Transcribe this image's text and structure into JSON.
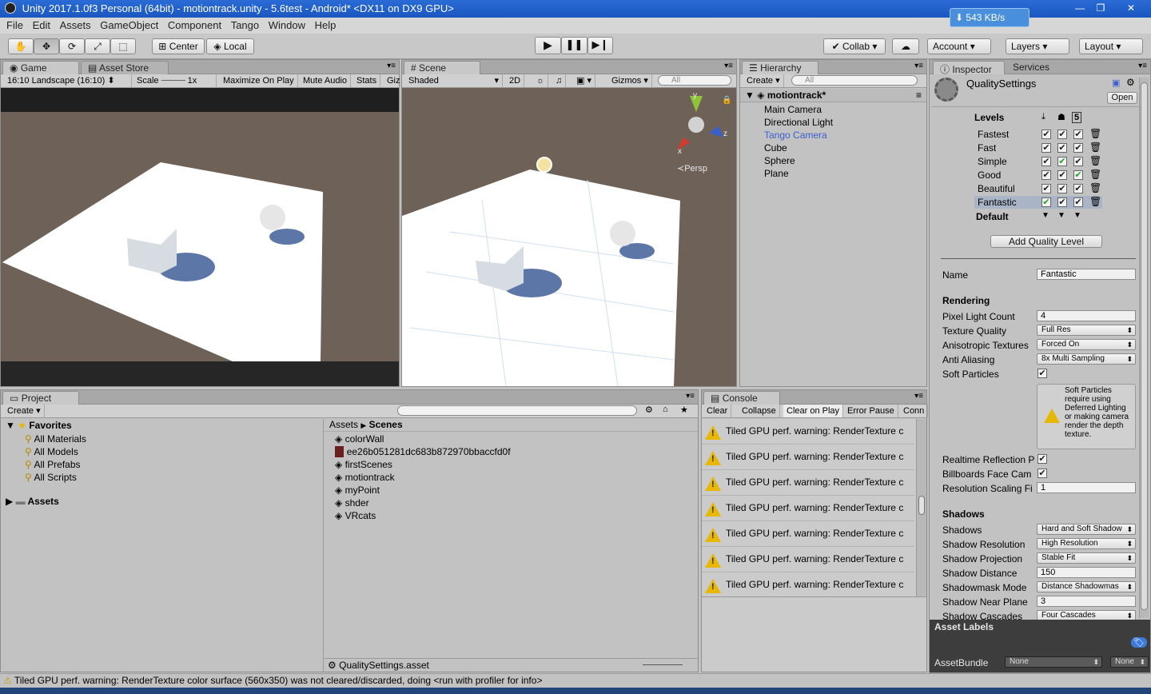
{
  "window": {
    "title": "Unity 2017.1.0f3 Personal (64bit) - motiontrack.unity - 5.6test - Android* <DX11 on DX9 GPU>",
    "speed": "543 KB/s"
  },
  "menu": [
    "File",
    "Edit",
    "Assets",
    "GameObject",
    "Component",
    "Tango",
    "Window",
    "Help"
  ],
  "toolbar": {
    "pivot": "Center",
    "space": "Local",
    "collab": "Collab",
    "account": "Account",
    "layers": "Layers",
    "layout": "Layout"
  },
  "game": {
    "tab": "Game",
    "tab2": "Asset Store",
    "aspect": "16:10 Landscape (16:10)",
    "scale_label": "Scale",
    "scale_value": "1x",
    "maximize": "Maximize On Play",
    "mute": "Mute Audio",
    "stats": "Stats",
    "gizmos": "Giz"
  },
  "scene": {
    "tab": "Scene",
    "shading": "Shaded",
    "mode2d": "2D",
    "gizmos": "Gizmos",
    "search_placeholder": "All",
    "persp": "Persp",
    "axis_y": "y",
    "axis_x": "x",
    "axis_z": "z"
  },
  "hierarchy": {
    "tab": "Hierarchy",
    "create": "Create",
    "search_placeholder": "All",
    "scene_name": "motiontrack*",
    "items": [
      "Main Camera",
      "Directional Light",
      "Tango Camera",
      "Cube",
      "Sphere",
      "Plane"
    ]
  },
  "inspector": {
    "tab": "Inspector",
    "tab2": "Services",
    "asset_title": "QualitySettings",
    "open": "Open",
    "levels_header": "Levels",
    "levels": [
      {
        "name": "Fastest",
        "c1": "✔",
        "c2": "✔",
        "c3": "✔",
        "g1": false,
        "g2": false,
        "g3": false
      },
      {
        "name": "Fast",
        "c1": "✔",
        "c2": "✔",
        "c3": "✔",
        "g1": false,
        "g2": false,
        "g3": false
      },
      {
        "name": "Simple",
        "c1": "✔",
        "c2": "✔",
        "c3": "✔",
        "g1": false,
        "g2": true,
        "g3": false
      },
      {
        "name": "Good",
        "c1": "✔",
        "c2": "✔",
        "c3": "✔",
        "g1": false,
        "g2": false,
        "g3": true
      },
      {
        "name": "Beautiful",
        "c1": "✔",
        "c2": "✔",
        "c3": "✔",
        "g1": false,
        "g2": false,
        "g3": false
      },
      {
        "name": "Fantastic",
        "c1": "✔",
        "c2": "✔",
        "c3": "✔",
        "g1": true,
        "g2": false,
        "g3": false
      }
    ],
    "default_label": "Default",
    "add_level": "Add Quality Level",
    "name_label": "Name",
    "name_value": "Fantastic",
    "rendering_header": "Rendering",
    "pixel_light_label": "Pixel Light Count",
    "pixel_light_value": "4",
    "texture_quality_label": "Texture Quality",
    "texture_quality_value": "Full Res",
    "aniso_label": "Anisotropic Textures",
    "aniso_value": "Forced On",
    "aa_label": "Anti Aliasing",
    "aa_value": "8x Multi Sampling",
    "soft_particles_label": "Soft Particles",
    "soft_particles_warning": "Soft Particles require using Deferred Lighting or making camera render the depth texture.",
    "realtime_refl_label": "Realtime Reflection P",
    "billboards_label": "Billboards Face Cam",
    "res_scaling_label": "Resolution Scaling Fi",
    "res_scaling_value": "1",
    "shadows_header": "Shadows",
    "shadows_label": "Shadows",
    "shadows_value": "Hard and Soft Shadow",
    "shadow_res_label": "Shadow Resolution",
    "shadow_res_value": "High Resolution",
    "shadow_proj_label": "Shadow Projection",
    "shadow_proj_value": "Stable Fit",
    "shadow_dist_label": "Shadow Distance",
    "shadow_dist_value": "150",
    "shadowmask_label": "Shadowmask Mode",
    "shadowmask_value": "Distance Shadowmas",
    "near_plane_label": "Shadow Near Plane",
    "near_plane_value": "3",
    "cascades_label": "Shadow Cascades",
    "cascades_value": "Four Cascades",
    "asset_labels": "Asset Labels",
    "asset_bundle": "AssetBundle",
    "bundle_value": "None",
    "bundle_variant": "None"
  },
  "project": {
    "tab": "Project",
    "create": "Create",
    "favorites": "Favorites",
    "fav_items": [
      "All Materials",
      "All Models",
      "All Prefabs",
      "All Scripts"
    ],
    "assets_root": "Assets",
    "breadcrumb_root": "Assets",
    "breadcrumb_leaf": "Scenes",
    "files": [
      "colorWall",
      "ee26b051281dc683b872970bbaccfd0f",
      "firstScenes",
      "motiontrack",
      "myPoint",
      "shder",
      "VRcats"
    ],
    "selected_file": "QualitySettings.asset"
  },
  "console": {
    "tab": "Console",
    "buttons": [
      "Clear",
      "Collapse",
      "Clear on Play",
      "Error Pause",
      "Conn"
    ],
    "message": "Tiled GPU perf. warning: RenderTexture c",
    "count": 7
  },
  "status": {
    "message": "Tiled GPU perf. warning: RenderTexture color surface  (560x350) was not cleared/discarded, doing <run with profiler for info>"
  },
  "colors": {
    "accent_blue": "#3b5ed1",
    "warning": "#e8b800",
    "green_check": "#2b9a2b"
  }
}
